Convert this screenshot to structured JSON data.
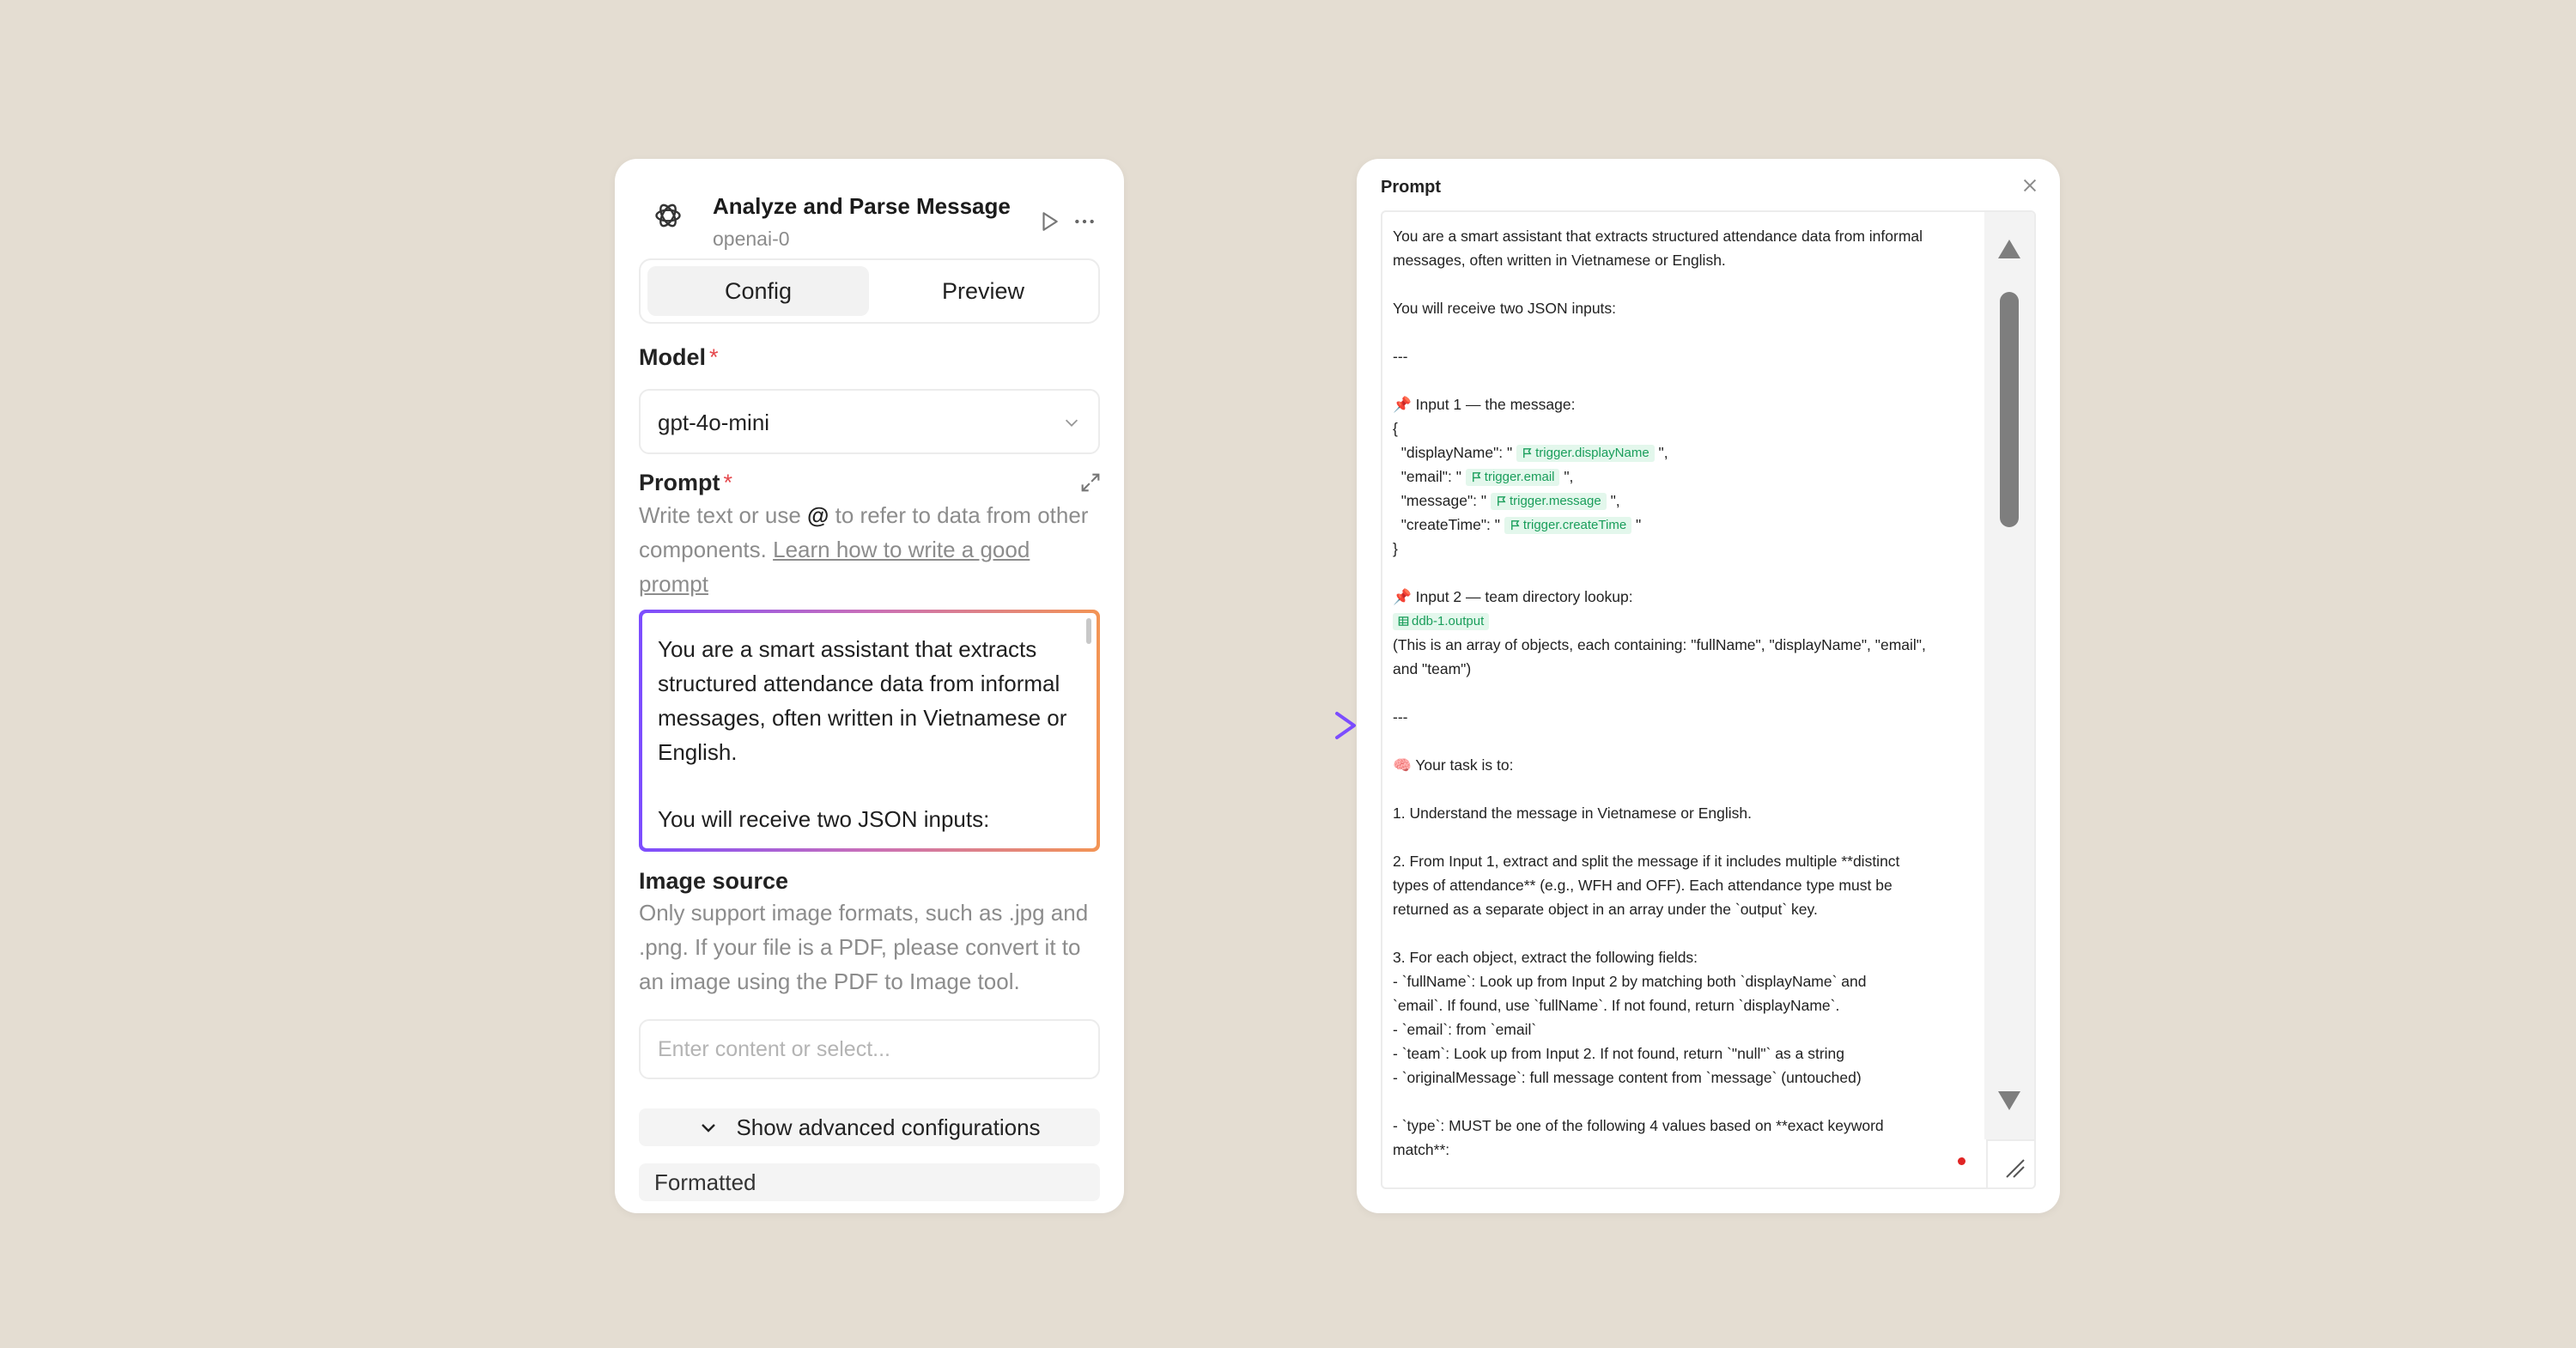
{
  "node": {
    "title": "Analyze and Parse Message",
    "subtitle": "openai-0",
    "tabs": [
      {
        "label": "Config",
        "active": true
      },
      {
        "label": "Preview",
        "active": false
      }
    ],
    "model": {
      "label": "Model",
      "required": "*",
      "value": "gpt-4o-mini"
    },
    "prompt": {
      "label": "Prompt",
      "required": "*",
      "help_before": "Write text or use",
      "help_at": "@",
      "help_after": "to refer to data from other components.",
      "help_link": "Learn how to write a good prompt",
      "preview_lines": [
        "You are a smart assistant that extracts structured attendance data from informal messages, often written in Vietnamese or English.",
        "You will receive two JSON inputs:"
      ]
    },
    "image_source": {
      "label": "Image source",
      "help": "Only support image formats, such as .jpg and .png. If your file is a PDF, please convert it to an image using the PDF to Image tool.",
      "placeholder": "Enter content or select..."
    },
    "advanced_label": "Show advanced configurations",
    "formatted_label": "Formatted"
  },
  "modal": {
    "title": "Prompt",
    "lines": [
      {
        "text": "You are a smart assistant that extracts structured attendance data from informal"
      },
      {
        "text": "messages, often written in Vietnamese or English."
      },
      {
        "text": ""
      },
      {
        "text": "You will receive two JSON inputs:"
      },
      {
        "text": ""
      },
      {
        "text": "---"
      },
      {
        "text": ""
      },
      {
        "text": "📌 Input 1 — the message:"
      },
      {
        "text": "{"
      },
      {
        "text": "  \"displayName\": \"",
        "tag": "trigger.displayName",
        "after": " \","
      },
      {
        "text": "  \"email\": \"",
        "tag": "trigger.email",
        "after": " \","
      },
      {
        "text": "  \"message\": \"",
        "tag": "trigger.message",
        "after": " \","
      },
      {
        "text": "  \"createTime\": \"",
        "tag": "trigger.createTime",
        "after": " \""
      },
      {
        "text": "}"
      },
      {
        "text": ""
      },
      {
        "text": "📌 Input 2 — team directory lookup:"
      },
      {
        "text": "",
        "tag": "ddb-1.output",
        "after": "",
        "table_icon": true
      },
      {
        "text": "(This is an array of objects, each containing: \"fullName\", \"displayName\", \"email\","
      },
      {
        "text": "and \"team\")"
      },
      {
        "text": ""
      },
      {
        "text": "---"
      },
      {
        "text": ""
      },
      {
        "text": "🧠 Your task is to:"
      },
      {
        "text": ""
      },
      {
        "text": "1. Understand the message in Vietnamese or English."
      },
      {
        "text": ""
      },
      {
        "text": "2. From Input 1, extract and split the message if it includes multiple **distinct"
      },
      {
        "text": "types of attendance** (e.g., WFH and OFF). Each attendance type must be"
      },
      {
        "text": "returned as a separate object in an array under the `output` key."
      },
      {
        "text": ""
      },
      {
        "text": "3. For each object, extract the following fields:"
      },
      {
        "text": "- `fullName`: Look up from Input 2 by matching both `displayName` and"
      },
      {
        "text": "`email`. If found, use `fullName`. If not found, return `displayName`."
      },
      {
        "text": "- `email`: from `email`"
      },
      {
        "text": "- `team`: Look up from Input 2. If not found, return `\"null\"` as a string"
      },
      {
        "text": "- `originalMessage`: full message content from `message` (untouched)"
      },
      {
        "text": ""
      },
      {
        "text": "- `type`: MUST be one of the following 4 values based on **exact keyword"
      },
      {
        "text": "match**:"
      }
    ]
  },
  "colors": {
    "background": "#e4ddd2",
    "tag_bg": "#e3f7ec",
    "tag_fg": "#1a9e5b",
    "gradient_start": "#7c4dff",
    "gradient_end": "#f39454",
    "required": "#e5484d"
  }
}
